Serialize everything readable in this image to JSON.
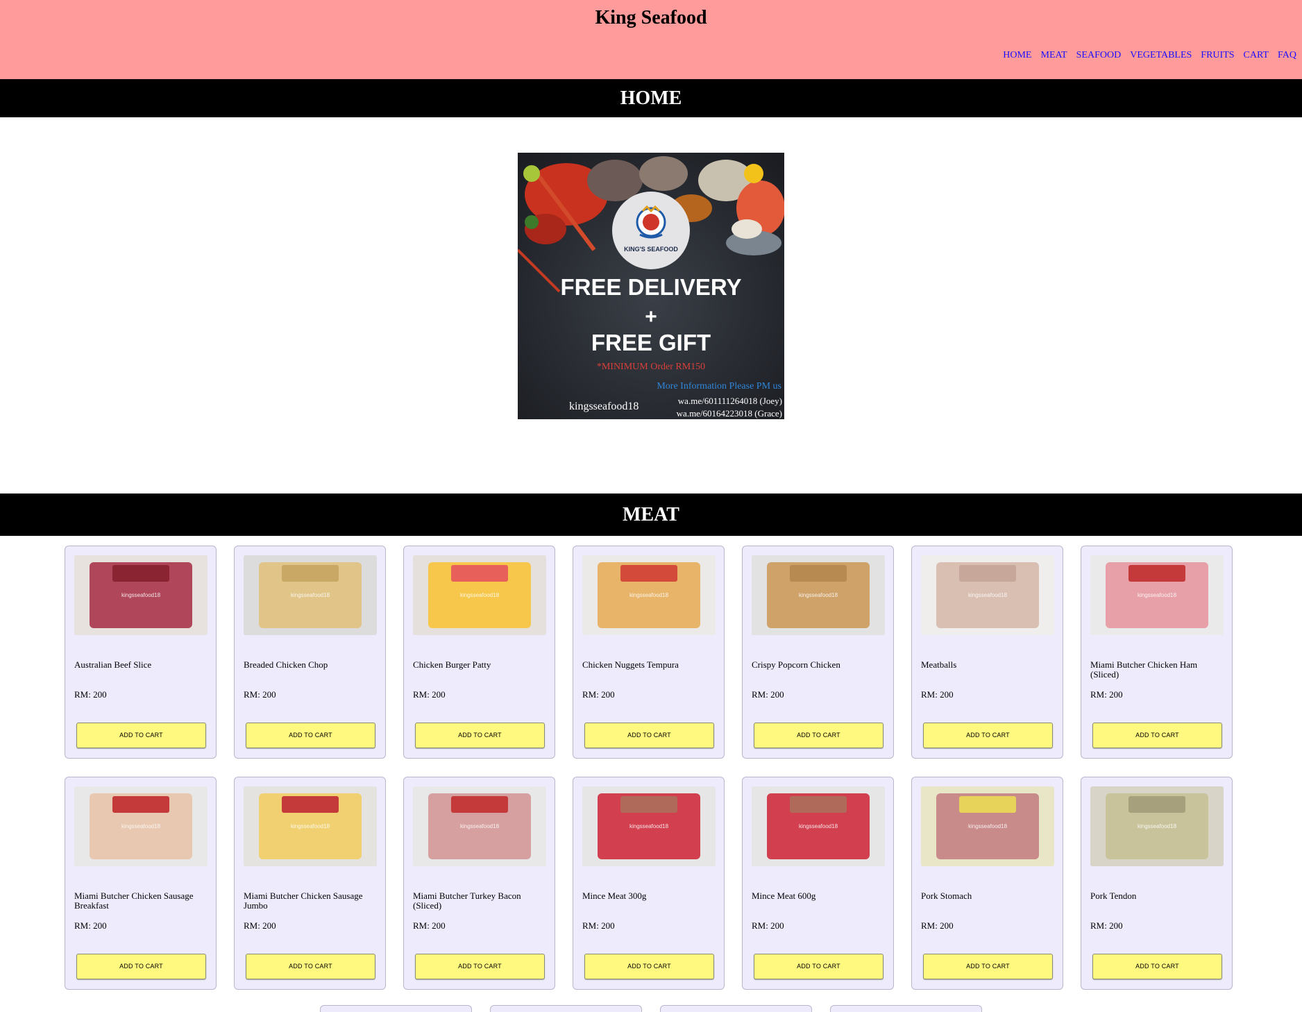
{
  "site": {
    "title": "King Seafood",
    "nav": [
      "HOME",
      "MEAT",
      "SEAFOOD",
      "VEGETABLES",
      "FRUITS",
      "CART",
      "FAQ"
    ]
  },
  "colors": {
    "header_bg": "#ff9b9b",
    "nav_link": "#1a0dff",
    "section_bar": "#000000",
    "card_bg": "#eeecfc",
    "button_bg": "#fffa7f"
  },
  "sections": {
    "home": "HOME",
    "meat": "MEAT"
  },
  "banner": {
    "brand": "KING'S SEAFOOD",
    "line1": "FREE DELIVERY",
    "plus": "+",
    "line2": "FREE GIFT",
    "min_order": "*MINIMUM Order RM150",
    "more_info": "More Information Please PM us",
    "handle": "kingsseafood18",
    "contact1": "wa.me/601111264018 (Joey)",
    "contact2": "wa.me/60164223018 (Grace)"
  },
  "products": [
    {
      "name": "Australian Beef Slice",
      "price": "RM: 200",
      "button": "ADD TO CART",
      "icon": "beef-slice-photo"
    },
    {
      "name": "Breaded Chicken Chop",
      "price": "RM: 200",
      "button": "ADD TO CART",
      "icon": "chicken-chop-photo"
    },
    {
      "name": "Chicken Burger Patty",
      "price": "RM: 200",
      "button": "ADD TO CART",
      "icon": "burger-patty-photo"
    },
    {
      "name": "Chicken Nuggets Tempura",
      "price": "RM: 200",
      "button": "ADD TO CART",
      "icon": "nuggets-photo"
    },
    {
      "name": "Crispy Popcorn Chicken",
      "price": "RM: 200",
      "button": "ADD TO CART",
      "icon": "popcorn-chicken-photo"
    },
    {
      "name": "Meatballs",
      "price": "RM: 200",
      "button": "ADD TO CART",
      "icon": "meatballs-photo"
    },
    {
      "name": "Miami Butcher Chicken Ham (Sliced)",
      "price": "RM: 200",
      "button": "ADD TO CART",
      "icon": "chicken-ham-photo"
    },
    {
      "name": "Miami Butcher Chicken Sausage Breakfast",
      "price": "RM: 200",
      "button": "ADD TO CART",
      "icon": "sausage-breakfast-photo"
    },
    {
      "name": "Miami Butcher Chicken Sausage Jumbo",
      "price": "RM: 200",
      "button": "ADD TO CART",
      "icon": "sausage-jumbo-photo"
    },
    {
      "name": "Miami Butcher Turkey Bacon (Sliced)",
      "price": "RM: 200",
      "button": "ADD TO CART",
      "icon": "turkey-bacon-photo"
    },
    {
      "name": "Mince Meat 300g",
      "price": "RM: 200",
      "button": "ADD TO CART",
      "icon": "mince-meat-photo"
    },
    {
      "name": "Mince Meat 600g",
      "price": "RM: 200",
      "button": "ADD TO CART",
      "icon": "mince-meat-photo"
    },
    {
      "name": "Pork Stomach",
      "price": "RM: 200",
      "button": "ADD TO CART",
      "icon": "pork-stomach-photo"
    },
    {
      "name": "Pork Tendon",
      "price": "RM: 200",
      "button": "ADD TO CART",
      "icon": "pork-tendon-photo"
    }
  ],
  "product_watermark": "kingsseafood18"
}
